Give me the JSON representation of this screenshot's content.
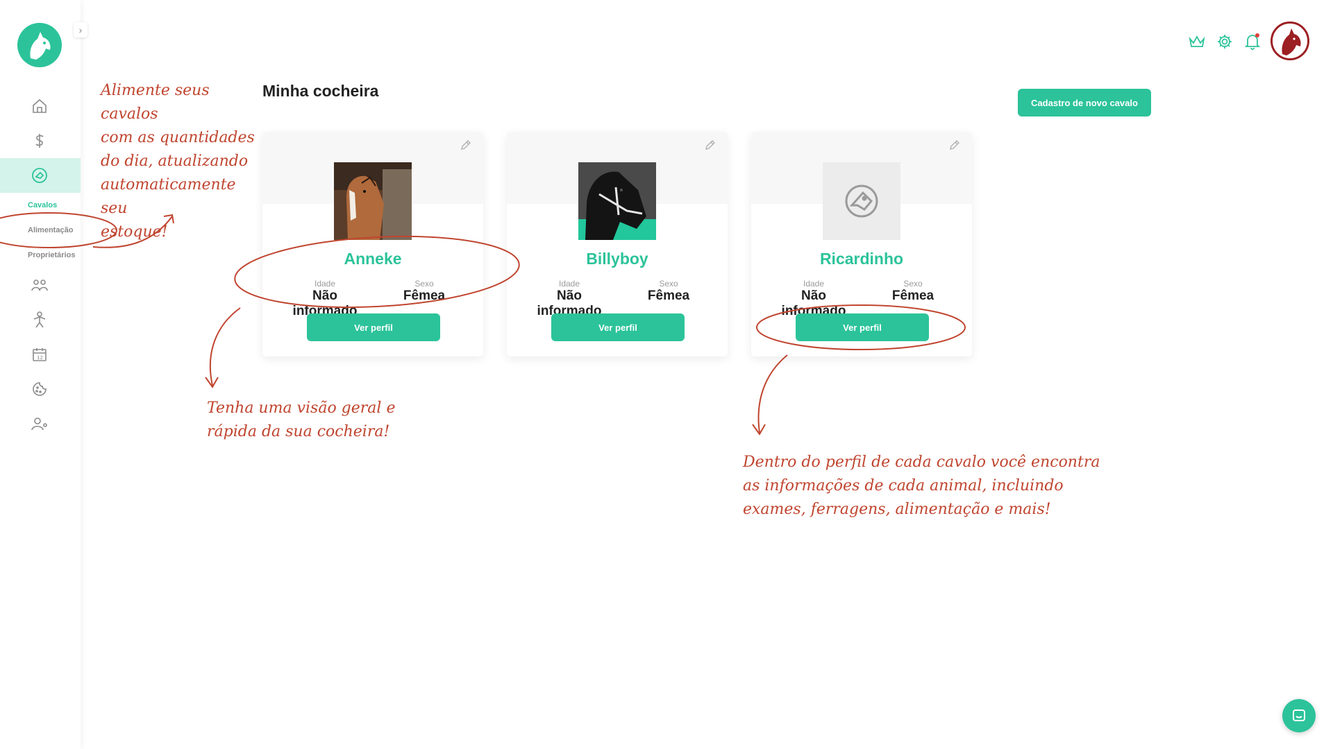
{
  "header": {
    "page_title": "Minha cocheira",
    "new_horse_button": "Cadastro de novo cavalo"
  },
  "sidebar": {
    "subitems": [
      {
        "label": "Cavalos",
        "active": true
      },
      {
        "label": "Alimentação",
        "active": false
      },
      {
        "label": "Proprietários",
        "active": false
      }
    ]
  },
  "cards": [
    {
      "name": "Anneke",
      "age_label": "Idade",
      "age": "Não informado",
      "sex_label": "Sexo",
      "sex": "Fêmea",
      "button": "Ver perfil",
      "photo": "chestnut-horse"
    },
    {
      "name": "Billyboy",
      "age_label": "Idade",
      "age": "Não informado",
      "sex_label": "Sexo",
      "sex": "Fêmea",
      "button": "Ver perfil",
      "photo": "black-horse"
    },
    {
      "name": "Ricardinho",
      "age_label": "Idade",
      "age": "Não informado",
      "sex_label": "Sexo",
      "sex": "Fêmea",
      "button": "Ver perfil",
      "photo": "placeholder-horse-icon"
    }
  ],
  "annotations": {
    "feed_note": [
      "Alimente seus cavalos",
      "com as quantidades",
      "do dia, atualizando",
      "automaticamente seu",
      "estoque!"
    ],
    "overview_note": [
      "Tenha uma visão geral e",
      "rápida da sua cocheira!"
    ],
    "profile_note": [
      "Dentro do perfil de cada cavalo você encontra",
      "as informações de cada animal, incluindo",
      "exames, ferragens, alimentação e mais!"
    ]
  },
  "colors": {
    "accent": "#2cc39a",
    "annotation": "#c0452f",
    "avatar_border": "#9c1f22"
  }
}
